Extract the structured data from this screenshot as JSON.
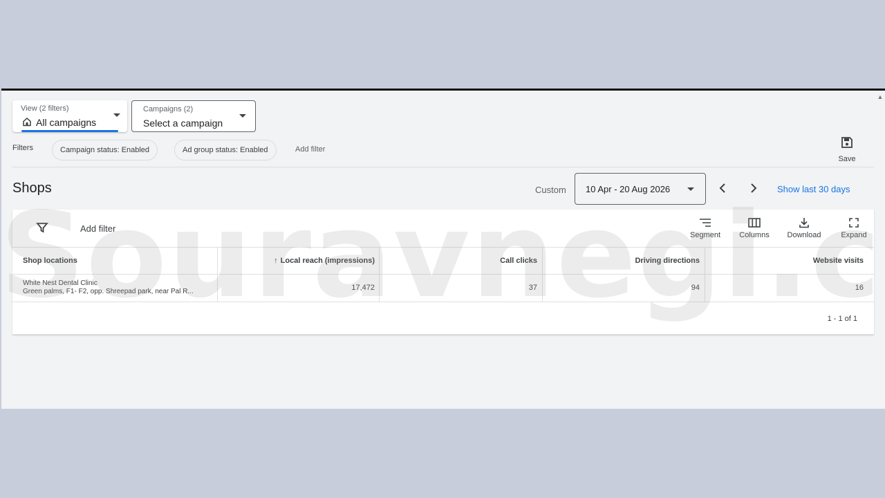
{
  "view_selector": {
    "small_label": "View (2 filters)",
    "value": "All campaigns"
  },
  "campaign_selector": {
    "small_label": "Campaigns (2)",
    "value": "Select a campaign"
  },
  "filters": {
    "label": "Filters",
    "chips": [
      "Campaign status: Enabled",
      "Ad group status: Enabled"
    ],
    "add_filter": "Add filter"
  },
  "save": {
    "label": "Save",
    "icon": "save-icon"
  },
  "page": {
    "title": "Shops"
  },
  "date_range": {
    "custom_label": "Custom",
    "value": "10 Apr - 20 Aug 2026",
    "show_last": "Show last 30 days"
  },
  "toolbar": {
    "add_filter": "Add filter",
    "segment": "Segment",
    "columns": "Columns",
    "download": "Download",
    "expand": "Expand"
  },
  "table": {
    "headers": {
      "shop_locations": "Shop locations",
      "local_reach": "Local reach (impressions)",
      "call_clicks": "Call clicks",
      "driving_directions": "Driving directions",
      "website_visits": "Website visits"
    },
    "sort_indicator": "↑",
    "rows": [
      {
        "name": "White Nest Dental Clinic",
        "address": "Green palms, F1- F2, opp. Shreepad park, near Pal R...",
        "local_reach": "17,472",
        "call_clicks": "37",
        "driving_directions": "94",
        "website_visits": "16"
      }
    ]
  },
  "pagination": "1 - 1 of 1",
  "watermark": "Souravnegi.com",
  "colors": {
    "accent": "#1a73e8",
    "background": "#f1f3f4",
    "outer": "#c8cddb"
  }
}
